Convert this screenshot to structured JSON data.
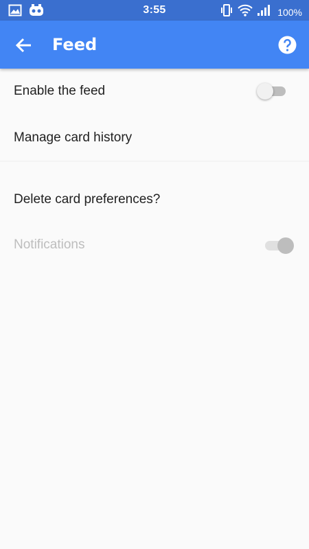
{
  "status_bar": {
    "time": "3:55",
    "battery": "100%",
    "icons": [
      "image-icon",
      "notification-icon",
      "vibrate-icon",
      "wifi-icon",
      "signal-icon"
    ]
  },
  "app_bar": {
    "title": "Feed",
    "back_icon": "arrow-back-icon",
    "help_icon": "help-icon",
    "color": "#4285f4"
  },
  "settings": {
    "enable_feed": {
      "label": "Enable the feed",
      "toggle": "off"
    },
    "manage_history": {
      "label": "Manage card history"
    },
    "delete_prefs": {
      "label": "Delete card preferences?"
    },
    "notifications": {
      "label": "Notifications",
      "toggle": "on",
      "enabled": false
    }
  }
}
